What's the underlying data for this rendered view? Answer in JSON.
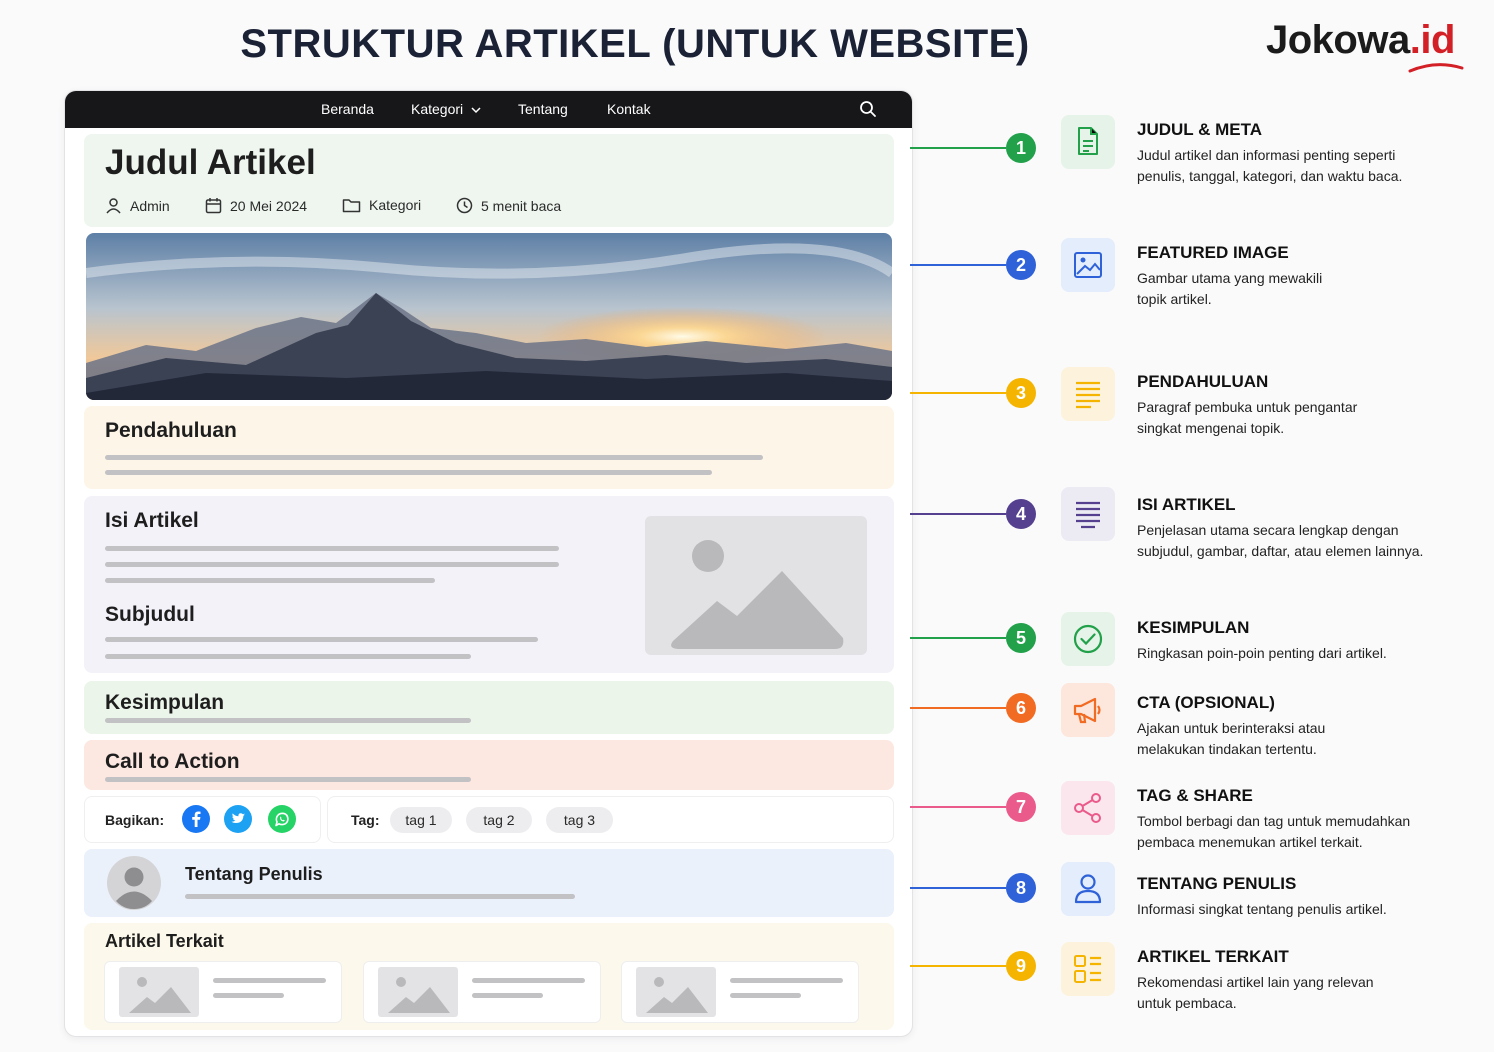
{
  "page_title": "STRUKTUR ARTIKEL (UNTUK WEBSITE)",
  "brand": {
    "main": "Jokowa",
    "accent": ".id"
  },
  "navbar": {
    "items": [
      "Beranda",
      "Kategori",
      "Tentang",
      "Kontak"
    ],
    "search_icon": "search-icon"
  },
  "article": {
    "title": "Judul Artikel",
    "meta": {
      "author": "Admin",
      "date": "20 Mei 2024",
      "category": "Kategori",
      "read_time": "5 menit baca"
    },
    "intro_title": "Pendahuluan",
    "body_title": "Isi Artikel",
    "subheading": "Subjudul",
    "conclusion_title": "Kesimpulan",
    "cta_title": "Call to Action",
    "share_label": "Bagikan:",
    "tag_label": "Tag:",
    "tags": [
      "tag 1",
      "tag 2",
      "tag 3"
    ],
    "author_box_title": "Tentang Penulis",
    "related_title": "Artikel Terkait"
  },
  "colors": {
    "meta_bg": "#eef6ef",
    "intro_bg": "#fdf5e7",
    "body_bg": "#f3f2f9",
    "conclusion_bg": "#ecf5ea",
    "cta_bg": "#fce7e1",
    "author_bg": "#eaf1fb",
    "related_bg": "#fdf8ec"
  },
  "legend": [
    {
      "num": "1",
      "color": "#22a14a",
      "tile_bg": "#e6f3e8",
      "icon": "document-icon",
      "title": "JUDUL & META",
      "desc": [
        "Judul artikel dan informasi penting seperti",
        "penulis, tanggal, kategori, dan waktu baca."
      ]
    },
    {
      "num": "2",
      "color": "#2f62d8",
      "tile_bg": "#e3edfb",
      "icon": "image-icon",
      "title": "FEATURED IMAGE",
      "desc": [
        "Gambar utama yang mewakili",
        "topik artikel."
      ]
    },
    {
      "num": "3",
      "color": "#f4b400",
      "tile_bg": "#fdf2dc",
      "icon": "paragraph-icon",
      "title": "PENDAHULUAN",
      "desc": [
        "Paragraf pembuka untuk pengantar",
        "singkat mengenai topik."
      ]
    },
    {
      "num": "4",
      "color": "#54408f",
      "tile_bg": "#ecebf4",
      "icon": "text-lines-icon",
      "title": "ISI ARTIKEL",
      "desc": [
        "Penjelasan utama secara lengkap dengan",
        "subjudul, gambar, daftar, atau elemen lainnya."
      ]
    },
    {
      "num": "5",
      "color": "#22a14a",
      "tile_bg": "#e6f3e8",
      "icon": "check-circle-icon",
      "title": "KESIMPULAN",
      "desc": [
        "Ringkasan poin-poin penting dari artikel."
      ]
    },
    {
      "num": "6",
      "color": "#f26b22",
      "tile_bg": "#fde6dc",
      "icon": "megaphone-icon",
      "title": "CTA (OPSIONAL)",
      "desc": [
        "Ajakan untuk berinteraksi atau",
        "melakukan tindakan tertentu."
      ]
    },
    {
      "num": "7",
      "color": "#ea5a8a",
      "tile_bg": "#fbe6ee",
      "icon": "share-icon",
      "title": "TAG & SHARE",
      "desc": [
        "Tombol berbagi dan tag untuk memudahkan",
        "pembaca menemukan artikel terkait."
      ]
    },
    {
      "num": "8",
      "color": "#2f62d8",
      "tile_bg": "#e3edfb",
      "icon": "user-icon",
      "title": "TENTANG PENULIS",
      "desc": [
        "Informasi singkat tentang penulis artikel."
      ]
    },
    {
      "num": "9",
      "color": "#f4b400",
      "tile_bg": "#fdf2dc",
      "icon": "grid-icon",
      "title": "ARTIKEL TERKAIT",
      "desc": [
        "Rekomendasi artikel lain yang relevan",
        "untuk pembaca."
      ]
    }
  ]
}
